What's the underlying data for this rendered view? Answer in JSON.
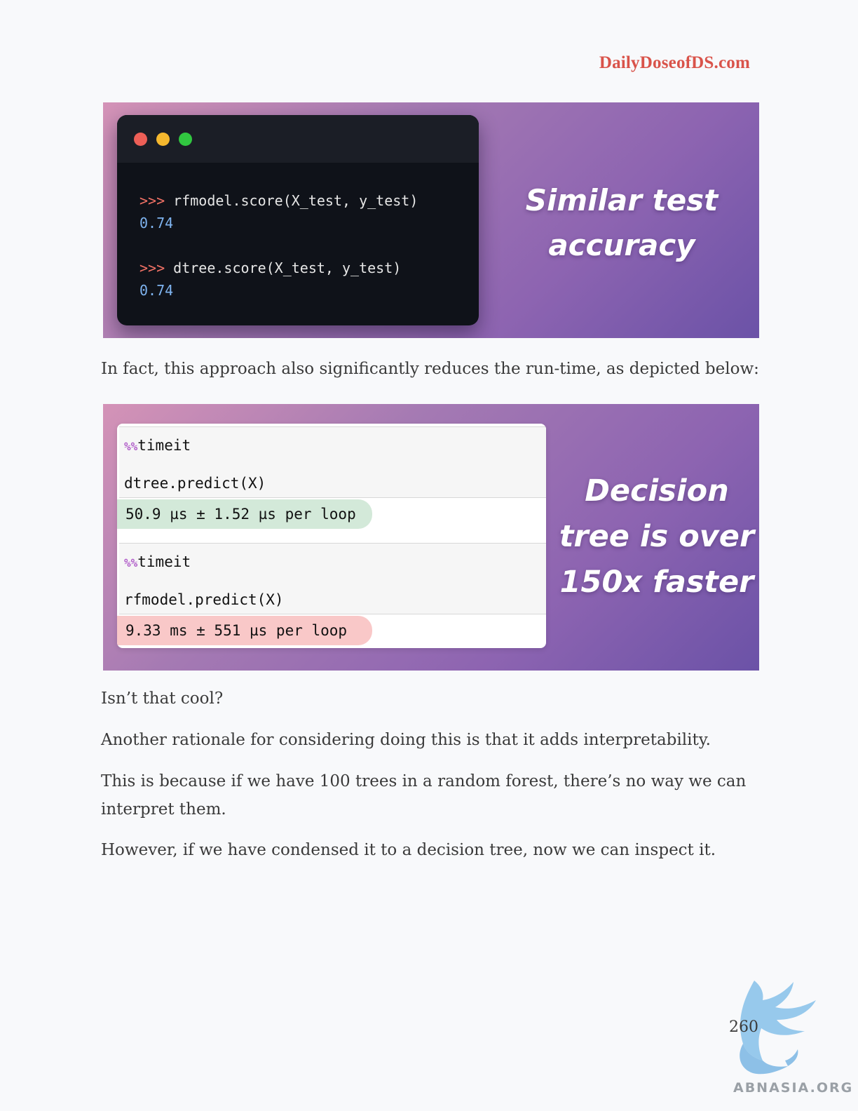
{
  "header": {
    "brand": "DailyDoseofDS.com"
  },
  "banner1": {
    "terminal": {
      "lines": [
        {
          "prompt": ">>>",
          "code": "rfmodel.score(X_test, y_test)",
          "result": "0.74"
        },
        {
          "prompt": ">>>",
          "code": "dtree.score(X_test, y_test)",
          "result": "0.74"
        }
      ]
    },
    "title_line1": "Similar test",
    "title_line2": "accuracy"
  },
  "paragraph1": "In fact, this approach also significantly reduces the run-time, as depicted below:",
  "banner2": {
    "cells": [
      {
        "magic": "%%",
        "command": "timeit",
        "code": "dtree.predict(X)",
        "output": "50.9 µs ± 1.52 µs per loop"
      },
      {
        "magic": "%%",
        "command": "timeit",
        "code": "rfmodel.predict(X)",
        "output": "9.33 ms ± 551 µs per loop"
      }
    ],
    "title_line1": "Decision",
    "title_line2": "tree is over",
    "title_line3": "150x faster"
  },
  "paragraphs": [
    "Isn’t that cool?",
    "Another rationale for considering doing this is that it adds interpretability.",
    "This is because if we have 100 trees in a random forest, there’s no way we can interpret them.",
    "However, if we have condensed it to a decision tree, now we can inspect it."
  ],
  "footer": {
    "page_number": "260",
    "watermark_text": "ABNASIA.ORG"
  },
  "colors": {
    "brand": "#d9534a",
    "output_good": "#d3e9d9",
    "output_bad": "#f9c8c8",
    "prompt": "#f27266",
    "result": "#7fb4f0"
  }
}
